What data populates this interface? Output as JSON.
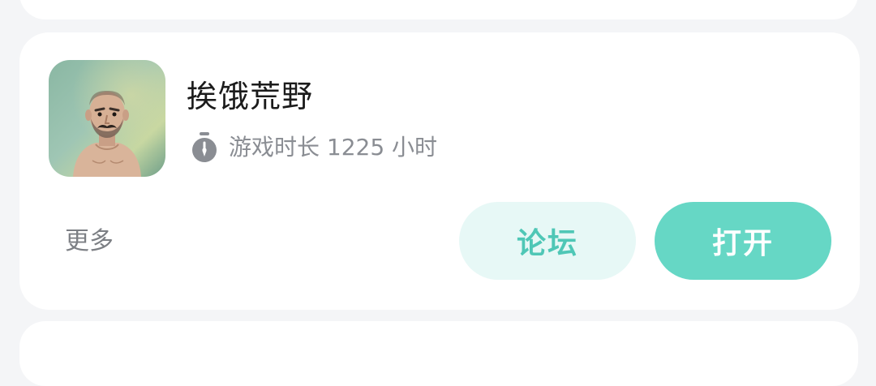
{
  "game": {
    "title": "挨饿荒野",
    "playtime": "游戏时长 1225 小时",
    "icon": "survivor-character-icon",
    "timer_icon": "stopwatch-icon"
  },
  "actions": {
    "more_label": "更多",
    "forum_label": "论坛",
    "open_label": "打开"
  },
  "colors": {
    "accent": "#66d7c5",
    "accent_light": "#e7f8f6",
    "accent_text": "#4fc7b6",
    "background": "#f4f5f7"
  }
}
